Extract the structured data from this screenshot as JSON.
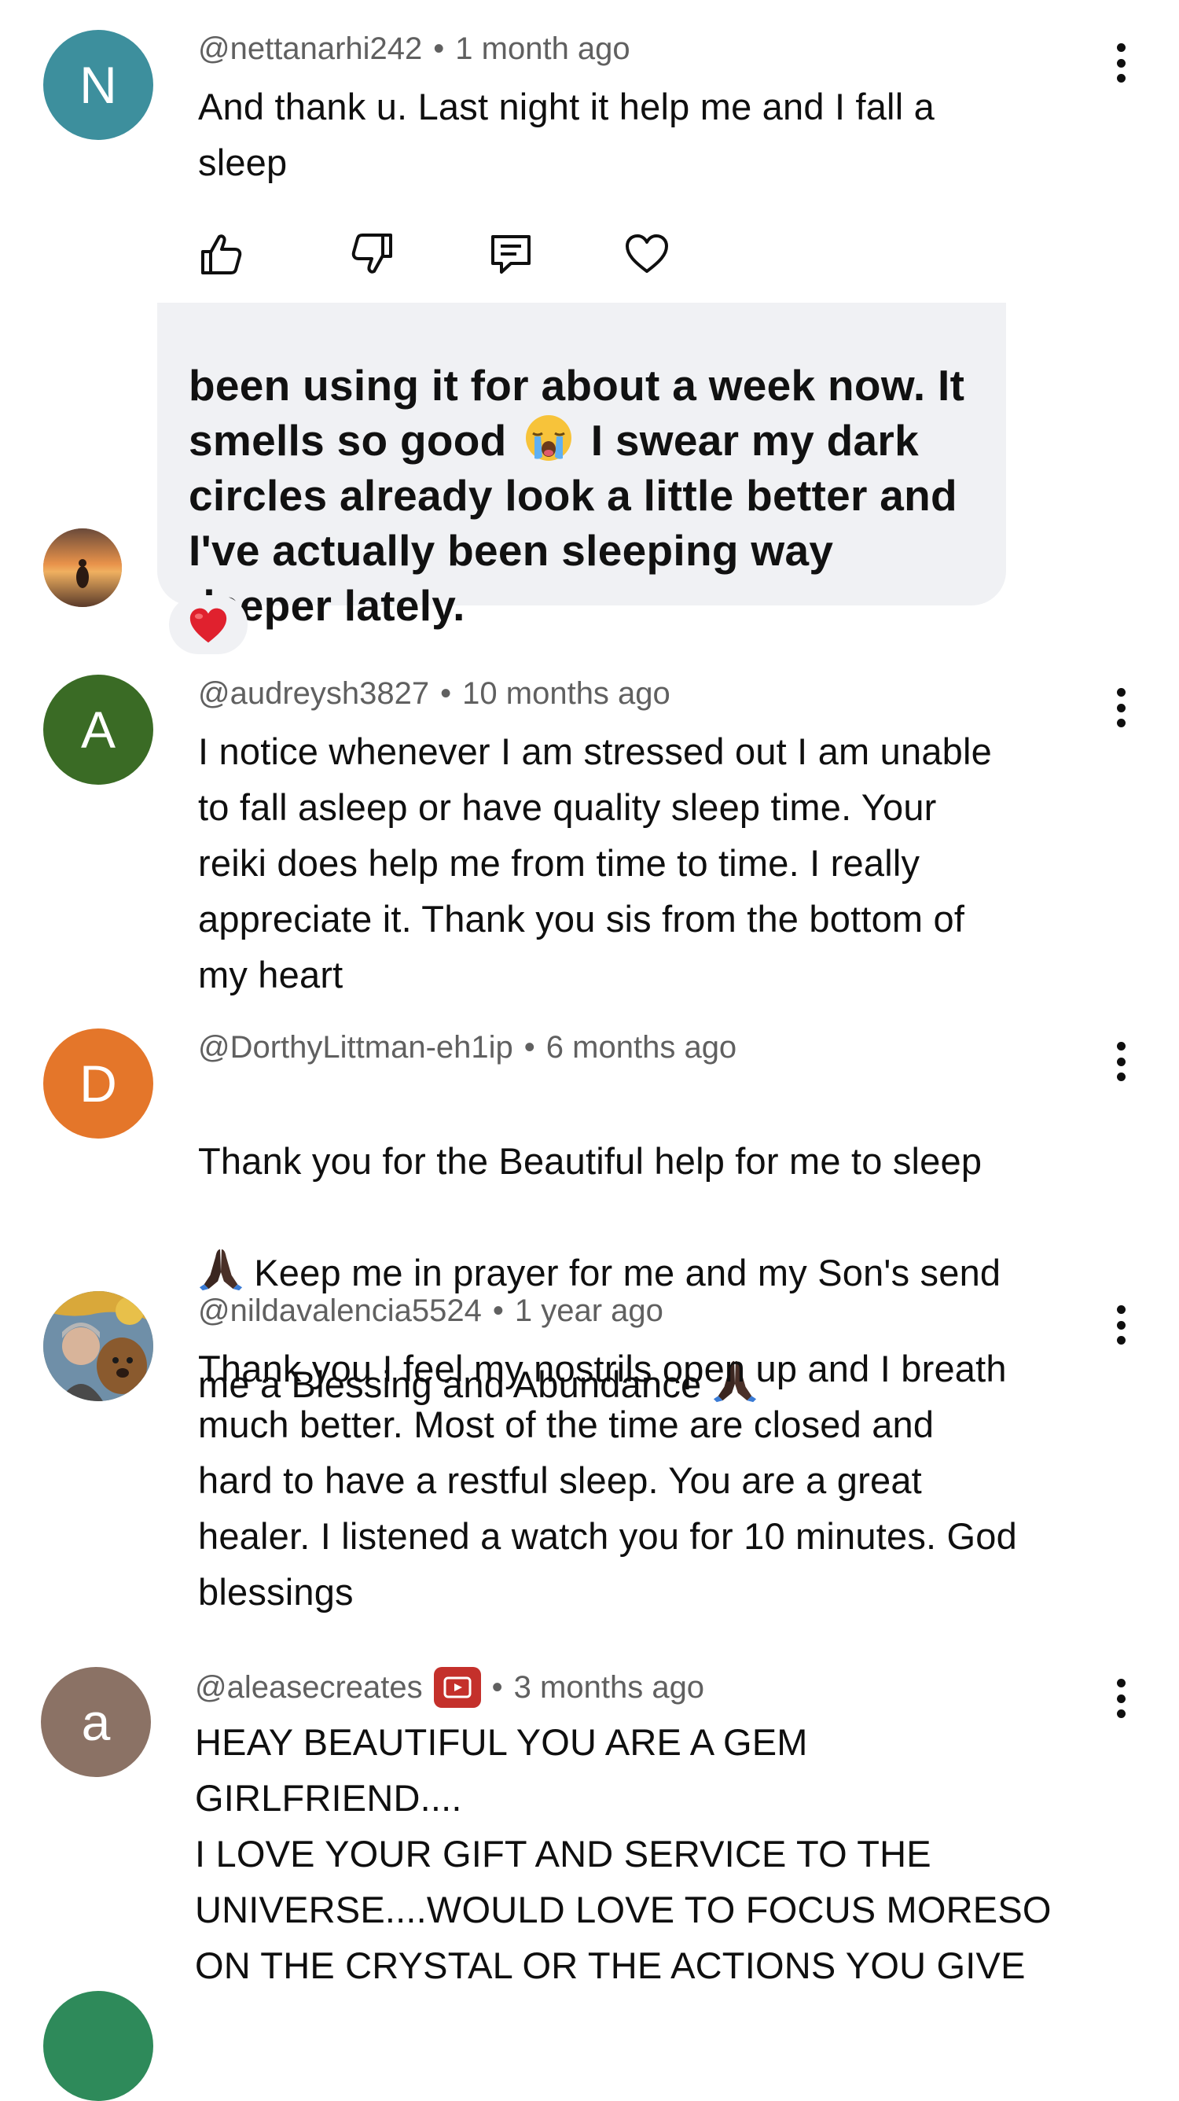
{
  "comments": [
    {
      "handle": "@nettanarhi242",
      "time": "1 month ago",
      "text": "And thank u. Last night it help me and I fall a\nsleep",
      "avatar_letter": "N",
      "avatar_color": "#3d8f9d"
    },
    {
      "handle": "@audreysh3827",
      "time": "10 months ago",
      "text": "I notice whenever I am stressed out I am unable\nto fall asleep or have quality sleep time. Your\nreiki does help me from time to time. I really\nappreciate it. Thank you sis from the bottom of\nmy heart",
      "avatar_letter": "A",
      "avatar_color": "#3a6b25"
    },
    {
      "handle": "@DorthyLittman-eh1ip",
      "time": "6 months ago",
      "line1": "Thank you for the Beautiful help for me to sleep",
      "line2": " Keep me in prayer for me and my Son's send",
      "line3": "me a Blessing and Abundance ",
      "avatar_letter": "D",
      "avatar_color": "#e4762a"
    },
    {
      "handle": "@nildavalencia5524",
      "time": "1 year ago",
      "text": "Thank you I feel my nostrils open up and I breath\nmuch better. Most of the time are closed and\nhard to have a restful sleep. You are a great\nhealer. I listened a watch you for 10 minutes. God\nblessings",
      "avatar_icon": "photo-avatar"
    },
    {
      "handle": "@aleasecreates",
      "time": "3 months ago",
      "text": "HEAY BEAUTIFUL YOU ARE  A GEM\nGIRLFRIEND....\nI LOVE YOUR GIFT AND SERVICE TO THE\nUNIVERSE....WOULD LOVE TO FOCUS MORESO\nON THE CRYSTAL OR THE ACTIONS YOU GIVE",
      "avatar_letter": "a",
      "avatar_color": "#8b7265"
    }
  ],
  "separator": "•",
  "message_bubble": {
    "text": "been using it for about a week now. It\nsmells so good  I swear my dark\ncircles already look a little better and\nI've actually been sleeping way\ndeeper lately.",
    "emoji_icon": "crying-face-emoji",
    "reaction_icon": "red-heart-emoji"
  },
  "actions": [
    "like-icon",
    "dislike-icon",
    "reply-icon",
    "heart-icon"
  ],
  "colors": {
    "text": "#0f0f0f",
    "meta": "#606060",
    "bubble_bg": "#f0f1f4",
    "heart": "#e0212e",
    "yt_red": "#c4302b"
  }
}
